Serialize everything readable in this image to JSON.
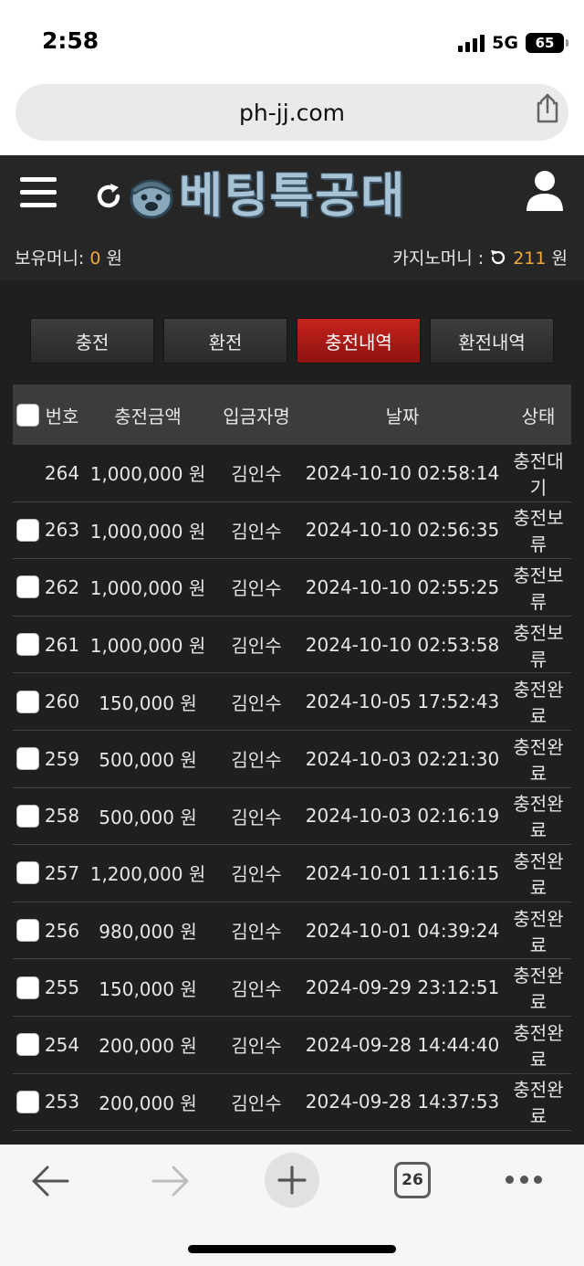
{
  "status_bar": {
    "time": "2:58",
    "network": "5G",
    "battery": "65"
  },
  "browser": {
    "url": "ph-jj.com",
    "tab_count": "26"
  },
  "header": {
    "logo_text": "베팅특공대",
    "money_label": "보유머니: ",
    "money_value": "0",
    "money_unit": " 원",
    "casino_label": "카지노머니 : ",
    "casino_value": "211",
    "casino_unit": " 원"
  },
  "tabs": [
    {
      "label": "충전",
      "active": false
    },
    {
      "label": "환전",
      "active": false
    },
    {
      "label": "충전내역",
      "active": true
    },
    {
      "label": "환전내역",
      "active": false
    }
  ],
  "table": {
    "columns": [
      "번호",
      "충전금액",
      "입금자명",
      "날짜",
      "상태"
    ],
    "rows": [
      {
        "no": "264",
        "amount": "1,000,000 원",
        "name": "김인수",
        "date": "2024-10-10 02:58:14",
        "status": "충전대기",
        "checkbox": false
      },
      {
        "no": "263",
        "amount": "1,000,000 원",
        "name": "김인수",
        "date": "2024-10-10 02:56:35",
        "status": "충전보류",
        "checkbox": true
      },
      {
        "no": "262",
        "amount": "1,000,000 원",
        "name": "김인수",
        "date": "2024-10-10 02:55:25",
        "status": "충전보류",
        "checkbox": true
      },
      {
        "no": "261",
        "amount": "1,000,000 원",
        "name": "김인수",
        "date": "2024-10-10 02:53:58",
        "status": "충전보류",
        "checkbox": true
      },
      {
        "no": "260",
        "amount": "150,000 원",
        "name": "김인수",
        "date": "2024-10-05 17:52:43",
        "status": "충전완료",
        "checkbox": true
      },
      {
        "no": "259",
        "amount": "500,000 원",
        "name": "김인수",
        "date": "2024-10-03 02:21:30",
        "status": "충전완료",
        "checkbox": true
      },
      {
        "no": "258",
        "amount": "500,000 원",
        "name": "김인수",
        "date": "2024-10-03 02:16:19",
        "status": "충전완료",
        "checkbox": true
      },
      {
        "no": "257",
        "amount": "1,200,000 원",
        "name": "김인수",
        "date": "2024-10-01 11:16:15",
        "status": "충전완료",
        "checkbox": true
      },
      {
        "no": "256",
        "amount": "980,000 원",
        "name": "김인수",
        "date": "2024-10-01 04:39:24",
        "status": "충전완료",
        "checkbox": true
      },
      {
        "no": "255",
        "amount": "150,000 원",
        "name": "김인수",
        "date": "2024-09-29 23:12:51",
        "status": "충전완료",
        "checkbox": true
      },
      {
        "no": "254",
        "amount": "200,000 원",
        "name": "김인수",
        "date": "2024-09-28 14:44:40",
        "status": "충전완료",
        "checkbox": true
      },
      {
        "no": "253",
        "amount": "200,000 원",
        "name": "김인수",
        "date": "2024-09-28 14:37:53",
        "status": "충전완료",
        "checkbox": true
      }
    ]
  },
  "colors": {
    "active_tab": "#b81c17",
    "accent": "#f0a93a",
    "background": "#1f1f1f",
    "header_bg": "#262626"
  }
}
